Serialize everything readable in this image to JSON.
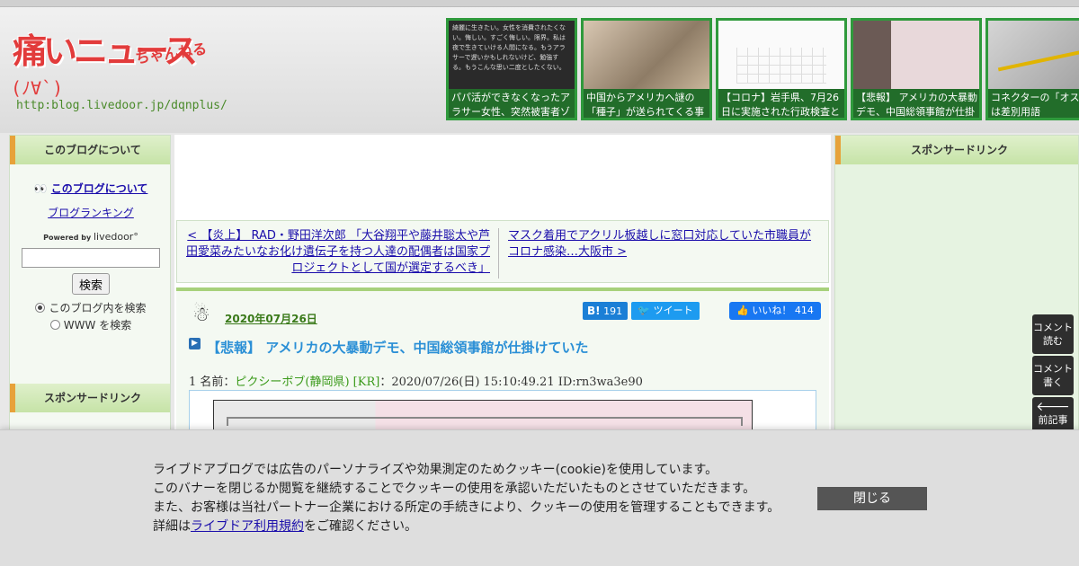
{
  "header": {
    "logo_text": "痛いニュース",
    "logo_chan": "ちゃんねる",
    "logo_face": "(ﾉ∀`)",
    "logo_url": "http:blog.livedoor.jp/dqnplus/",
    "thumb1_overlay": "綺麗に生きたい。女性を消費されたくない。悔しい。すごく悔しい。限界。私は夜で生きていける人間になる。もうアラサーで遅いかもしれないけど、勉強する。もうこんな思い二度としたくない。",
    "thumbnails": [
      {
        "caption": "パパ活ができなくなったアラサー女性、突然被害者ゾ"
      },
      {
        "caption": "中国からアメリカへ謎の「種子」が送られてくる事"
      },
      {
        "caption": "【コロナ】岩手県、7月26日に実施された行政検査と"
      },
      {
        "caption": "【悲報】 アメリカの大暴動デモ、中国総領事館が仕掛"
      },
      {
        "caption": "コネクターの「オス」表記は差別用語"
      }
    ]
  },
  "left": {
    "about_heading": "このブログについて",
    "about_link": "このブログについて",
    "ranking_link": "ブログランキング",
    "powered_by": "Powered by",
    "livedoor": "livedoor°",
    "search_button": "検索",
    "radio_this_blog": "このブログ内を検索",
    "radio_www": "WWW を検索",
    "sponsor_heading": "スポンサードリンク"
  },
  "nav": {
    "prev": "< 【炎上】 RAD・野田洋次郎 「大谷翔平や藤井聡太や芦田愛菜みたいなお化け遺伝子を持つ人達の配偶者は国家プロジェクトとして国が選定するべき」",
    "next": "マスク着用でアクリル板越しに窓口対応していた市職員がコロナ感染…大阪市 >"
  },
  "article": {
    "date": "2020年07月26日",
    "hatena_label": "B!",
    "hatena_count": "191",
    "tweet": "ツイート",
    "like": "いいね！",
    "like_count": "414",
    "title": "【悲報】 アメリカの大暴動デモ、中国総領事館が仕掛けていた",
    "post_prefix": "1 名前：",
    "post_name": "ピクシーボブ(静岡県) [KR]",
    "post_meta": "：2020/07/26(日) 15:10:49.21 ID:rn3wa3e90"
  },
  "right": {
    "sponsor_heading": "スポンサードリンク"
  },
  "side_buttons": {
    "read_comments": "コメント読む",
    "write_comment": "コメント書く",
    "prev_article": "前記事"
  },
  "cookie": {
    "line1": "ライブドアブログでは広告のパーソナライズや効果測定のためクッキー(cookie)を使用しています。",
    "line2": "このバナーを閉じるか閲覧を継続することでクッキーの使用を承認いただいたものとさせていただきます。",
    "line3": "また、お客様は当社パートナー企業における所定の手続きにより、クッキーの使用を管理することもできます。",
    "line4_prefix": "詳細は",
    "line4_link": "ライブドア利用規約",
    "line4_suffix": "をご確認ください。",
    "close_button": "閉じる"
  }
}
